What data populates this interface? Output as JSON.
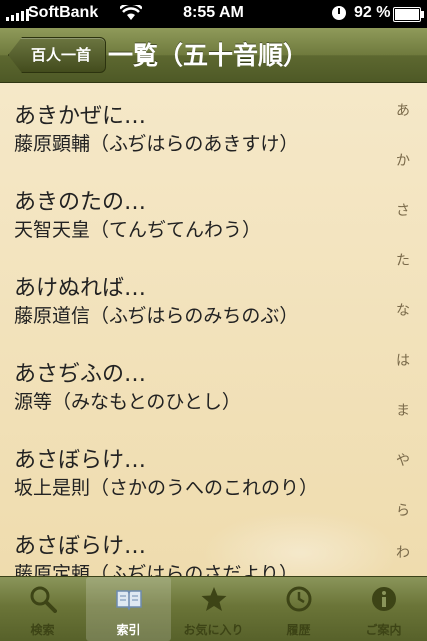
{
  "status_bar": {
    "carrier": "SoftBank",
    "time": "8:55 AM",
    "battery_percent": "92 %",
    "battery_level": 0.92
  },
  "nav_bar": {
    "back_label": "百人一首",
    "title": "一覧（五十音順）"
  },
  "poems": [
    {
      "poem": "あきかぜに…",
      "author": "藤原顕輔（ふぢはらのあきすけ）"
    },
    {
      "poem": "あきのたの…",
      "author": "天智天皇（てんぢてんわう）"
    },
    {
      "poem": "あけぬれば…",
      "author": "藤原道信（ふぢはらのみちのぶ）"
    },
    {
      "poem": "あさぢふの…",
      "author": "源等（みなもとのひとし）"
    },
    {
      "poem": "あさぼらけ…",
      "author": "坂上是則（さかのうへのこれのり）"
    },
    {
      "poem": "あさぼらけ…",
      "author": "藤原定頼（ふぢはらのさだより）"
    }
  ],
  "index_letters": [
    "あ",
    "か",
    "さ",
    "た",
    "な",
    "は",
    "ま",
    "や",
    "ら",
    "わ"
  ],
  "tabs": [
    {
      "label": "検索",
      "icon": "search-icon"
    },
    {
      "label": "索引",
      "icon": "book-icon"
    },
    {
      "label": "お気に入り",
      "icon": "star-icon"
    },
    {
      "label": "履歴",
      "icon": "history-clock-icon"
    },
    {
      "label": "ご案内",
      "icon": "info-icon"
    }
  ],
  "active_tab": 1
}
